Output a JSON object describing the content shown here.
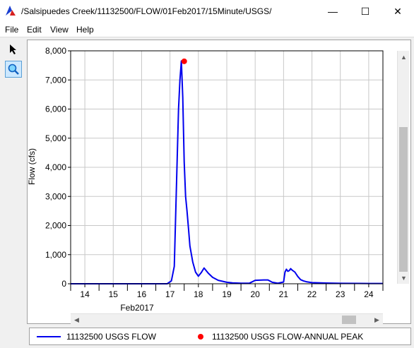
{
  "window": {
    "title": "/Salsipuedes Creek/11132500/FLOW/01Feb2017/15Minute/USGS/",
    "minimize": "—",
    "maximize": "☐",
    "close": "✕"
  },
  "menu": [
    "File",
    "Edit",
    "View",
    "Help"
  ],
  "tools": {
    "pointer": "pointer-icon",
    "zoom": "zoom-icon"
  },
  "legend": {
    "flow": "11132500 USGS FLOW",
    "peak": "11132500 USGS FLOW-ANNUAL PEAK"
  },
  "chart_data": {
    "type": "line",
    "ylabel": "Flow (cfs)",
    "xlabel": "Feb2017",
    "xlim": [
      13.5,
      24.5
    ],
    "ylim": [
      0,
      8000
    ],
    "yticks": [
      0,
      1000,
      2000,
      3000,
      4000,
      5000,
      6000,
      7000,
      8000
    ],
    "yticklabels": [
      "0",
      "1,000",
      "2,000",
      "3,000",
      "4,000",
      "5,000",
      "6,000",
      "7,000",
      "8,000"
    ],
    "xticks": [
      14,
      15,
      16,
      17,
      18,
      19,
      20,
      21,
      22,
      23,
      24
    ],
    "xticklabels": [
      "14",
      "15",
      "16",
      "17",
      "18",
      "19",
      "20",
      "21",
      "22",
      "23",
      "24"
    ],
    "grid": true,
    "series": [
      {
        "name": "11132500 USGS FLOW",
        "color": "#0000ee",
        "x": [
          13.5,
          14.0,
          15.0,
          16.0,
          16.9,
          17.05,
          17.15,
          17.25,
          17.3,
          17.35,
          17.4,
          17.45,
          17.5,
          17.55,
          17.6,
          17.65,
          17.7,
          17.8,
          17.9,
          18.0,
          18.1,
          18.15,
          18.2,
          18.25,
          18.35,
          18.5,
          18.7,
          19.0,
          19.2,
          19.5,
          19.8,
          20.0,
          20.3,
          20.45,
          20.6,
          20.8,
          21.0,
          21.05,
          21.1,
          21.15,
          21.2,
          21.25,
          21.3,
          21.4,
          21.5,
          21.6,
          21.7,
          21.8,
          22.0,
          22.5,
          23.0,
          24.0,
          24.5
        ],
        "y": [
          0,
          0,
          0,
          0,
          0,
          100,
          600,
          4200,
          6000,
          7000,
          7650,
          6400,
          4200,
          3000,
          2500,
          1900,
          1300,
          750,
          400,
          260,
          380,
          460,
          540,
          480,
          360,
          220,
          120,
          50,
          30,
          20,
          20,
          120,
          130,
          130,
          50,
          20,
          60,
          400,
          500,
          430,
          450,
          520,
          470,
          400,
          250,
          140,
          100,
          70,
          40,
          25,
          15,
          10,
          10
        ]
      }
    ],
    "peak": {
      "name": "11132500 USGS FLOW-ANNUAL PEAK",
      "color": "#ff0000",
      "x": 17.5,
      "y": 7640
    }
  }
}
